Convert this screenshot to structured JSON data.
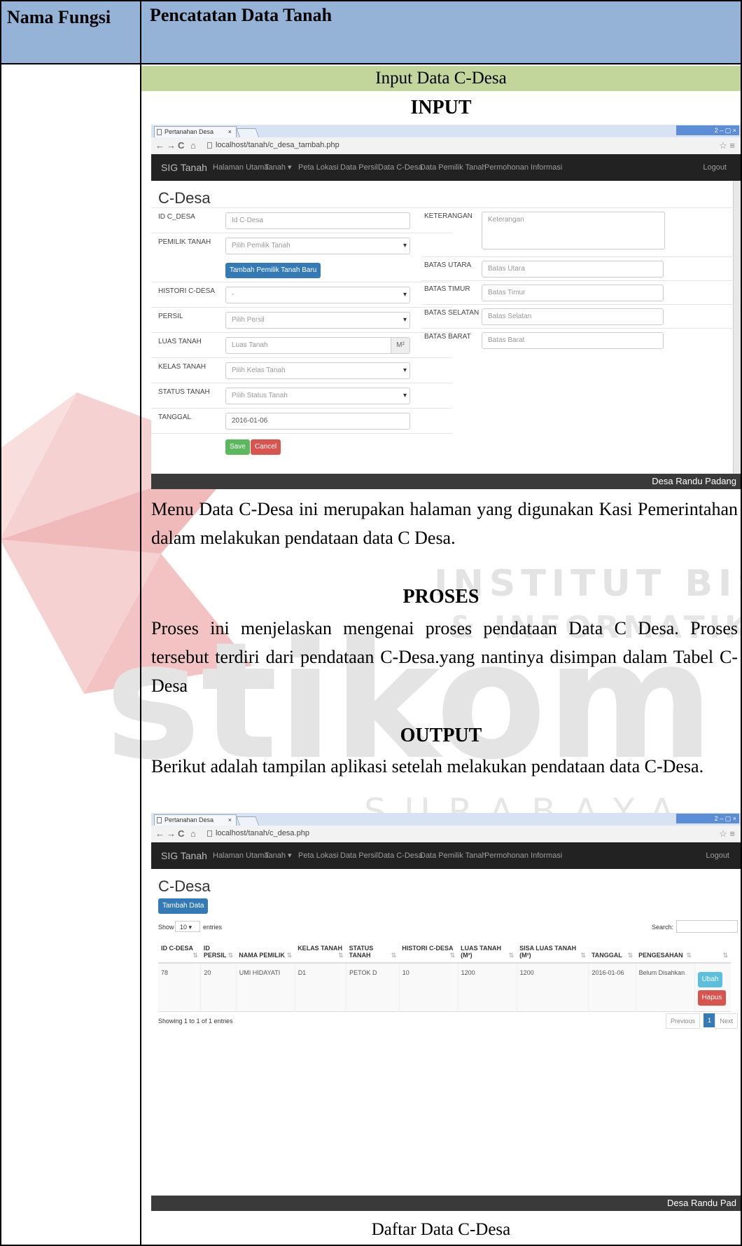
{
  "header": {
    "left_label": "Nama Fungsi",
    "right_label": "Pencatatan Data Tanah"
  },
  "section_title": "Input Data C-Desa",
  "input_heading": "INPUT",
  "proses_heading": "PROSES",
  "output_heading": "OUTPUT",
  "para_input": "Menu Data C-Desa ini merupakan halaman yang digunakan Kasi Pemerintahan dalam melakukan pendataan data C Desa.",
  "para_proses": "Proses ini menjelaskan mengenai proses pendataan Data C Desa. Proses tersebut terdiri dari pendataan C-Desa.yang nantinya disimpan dalam Tabel C-Desa",
  "para_output": "Berikut adalah tampilan aplikasi setelah melakukan pendataan data C-Desa.",
  "caption": "Daftar Data C-Desa",
  "watermark": {
    "line1": "INSTITUT BISNIS",
    "line2": "& INFORMATIKA",
    "line3": "stikom",
    "line4": "SURABAYA"
  },
  "browser": {
    "tab_title": "Pertanahan Desa",
    "tab_close": "×",
    "window_controls": "2  –  ▢  ×",
    "url_input": "localhost/tanah/c_desa_tambah.php",
    "url_output": "localhost/tanah/c_desa.php"
  },
  "navbar": {
    "brand": "SIG Tanah",
    "items": [
      "Halaman Utama",
      "Tanah ▾",
      "Peta Lokasi",
      "Data Persil",
      "Data C-Desa",
      "Data Pemilik Tanah",
      "Permohonan Informasi"
    ],
    "logout": "Logout"
  },
  "form": {
    "title": "C-Desa",
    "id_label": "ID C_DESA",
    "id_placeholder": "Id C-Desa",
    "pemilik_label": "PEMILIK TANAH",
    "pemilik_value": "Pilih Pemilik Tanah",
    "add_owner_button": "Tambah Pemilik Tanah Baru",
    "histori_label": "HISTORI C-DESA",
    "histori_value": "-",
    "persil_label": "PERSIL",
    "persil_value": "Pilih Persil",
    "luas_label": "LUAS TANAH",
    "luas_placeholder": "Luas Tanah",
    "luas_unit": "M²",
    "kelas_label": "KELAS TANAH",
    "kelas_value": "Pilih Kelas Tanah",
    "status_label": "STATUS TANAH",
    "status_value": "Pilih Status Tanah",
    "tanggal_label": "TANGGAL",
    "tanggal_value": "2016-01-06",
    "save_button": "Save",
    "cancel_button": "Cancel",
    "keterangan_label": "KETERANGAN",
    "keterangan_placeholder": "Keterangan",
    "utara_label": "BATAS UTARA",
    "utara_placeholder": "Batas Utara",
    "timur_label": "BATAS TIMUR",
    "timur_placeholder": "Batas Timur",
    "selatan_label": "BATAS SELATAN",
    "selatan_placeholder": "Batas Selatan",
    "barat_label": "BATAS BARAT",
    "barat_placeholder": "Batas Barat",
    "footer": "Desa Randu Padang"
  },
  "list": {
    "title": "C-Desa",
    "add_button": "Tambah Data",
    "show_label": "Show",
    "show_value": "10",
    "entries_label": "entries",
    "search_label": "Search:",
    "columns": [
      "ID C-DESA",
      "ID PERSIL",
      "NAMA PEMILIK",
      "KELAS TANAH",
      "STATUS TANAH",
      "HISTORI C-DESA",
      "LUAS TANAH (M²)",
      "SISA LUAS TANAH (M²)",
      "TANGGAL",
      "PENGESAHAN",
      ""
    ],
    "row": [
      "78",
      "20",
      "UMI HIDAYATI",
      "D1",
      "PETOK D",
      "10",
      "1200",
      "1200",
      "2016-01-06",
      "Belum Disahkan"
    ],
    "edit_button": "Ubah",
    "delete_button": "Hapus",
    "info": "Showing 1 to 1 of 1 entries",
    "prev": "Previous",
    "page": "1",
    "next": "Next",
    "footer": "Desa Randu Pad"
  }
}
